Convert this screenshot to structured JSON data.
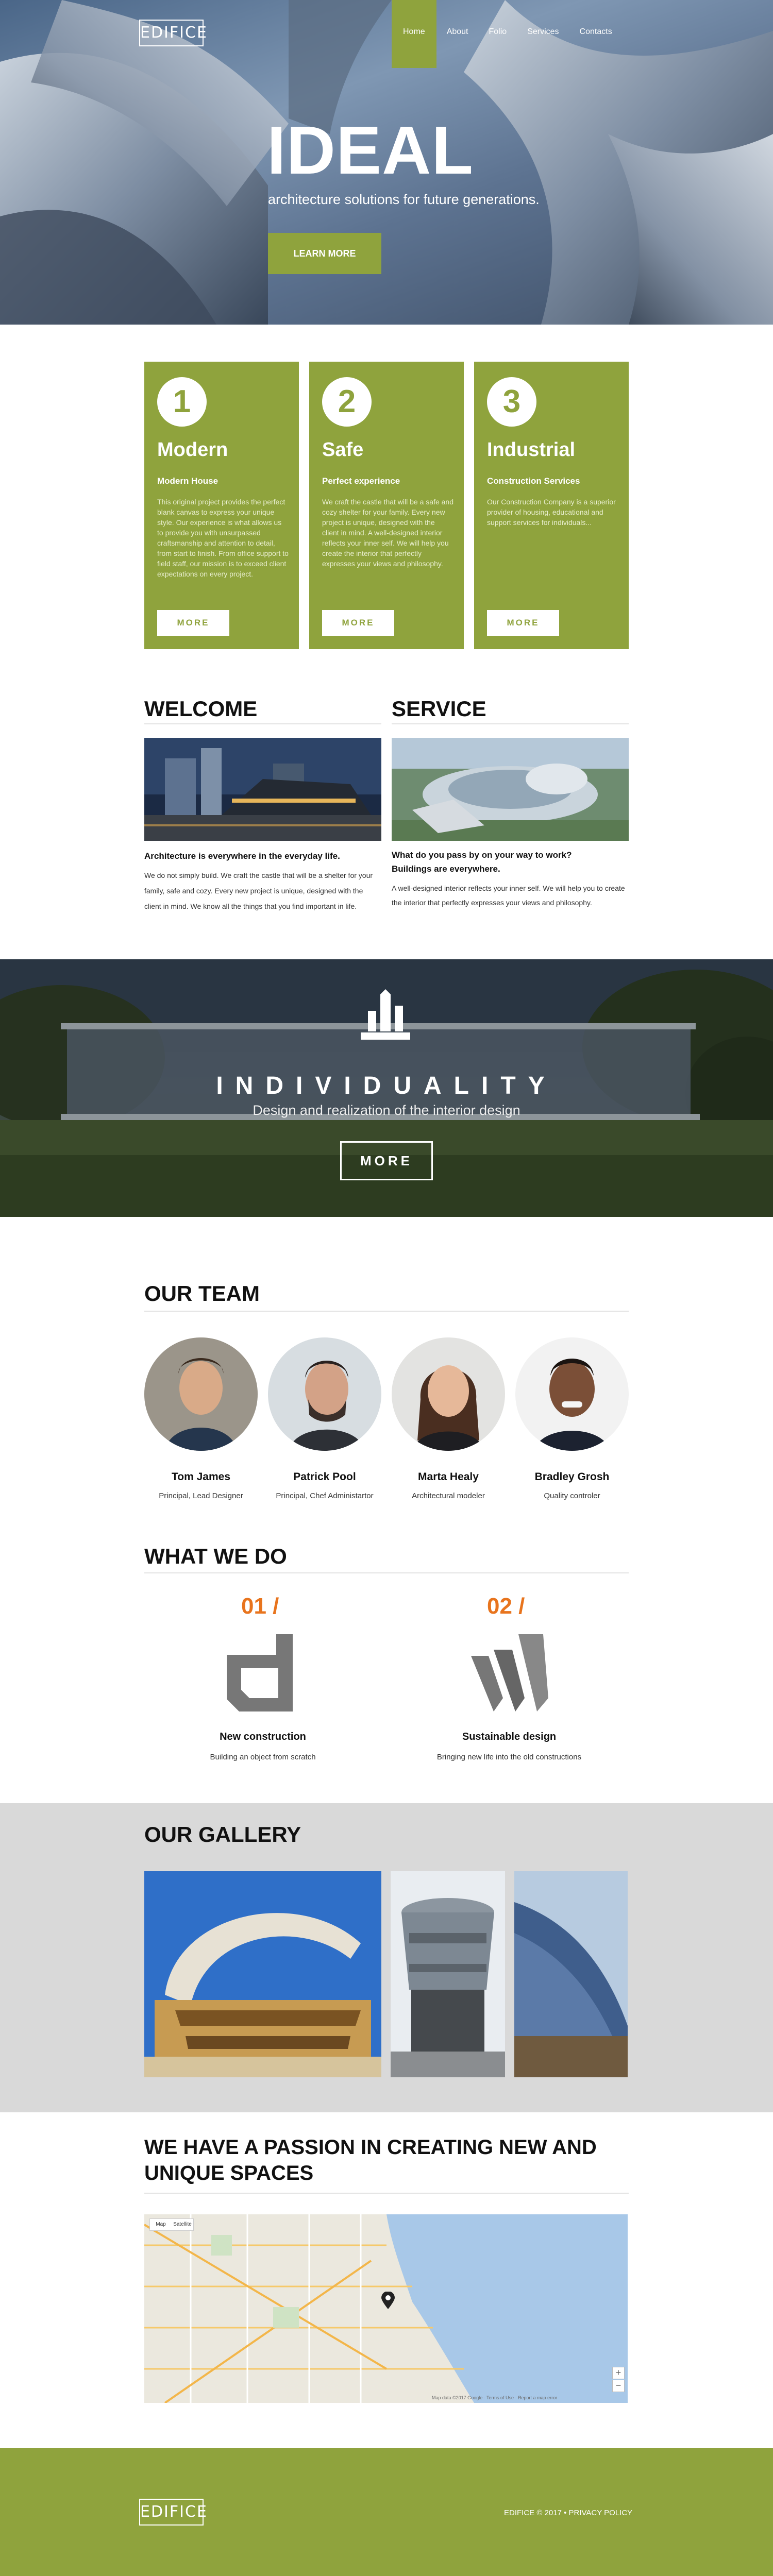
{
  "brand": {
    "logo_text": "EDIFICE",
    "accent_color": "#8fa33d",
    "orange": "#e8741d"
  },
  "nav": {
    "items": [
      "Home",
      "About",
      "Folio",
      "Services",
      "Contacts"
    ],
    "active": "Home"
  },
  "hero": {
    "title": "IDEAL",
    "subtitle": "architecture solutions for future generations.",
    "button": "LEARN MORE"
  },
  "features": [
    {
      "number": "1",
      "title": "Modern",
      "subtitle": "Modern House",
      "text": "This original project provides the perfect blank canvas to express your unique style. Our experience is what allows us to provide you with unsurpassed craftsmanship and attention to detail, from start to finish. From office support to field staff, our mission is to exceed client expectations on every project.",
      "button": "MORE"
    },
    {
      "number": "2",
      "title": "Safe",
      "subtitle": "Perfect experience",
      "text": "We craft the castle that will be a safe and cozy shelter for your family. Every new project is unique, designed with the client in mind. A well-designed interior reflects your inner self. We will help you create the interior that perfectly expresses your views and philosophy.",
      "button": "MORE"
    },
    {
      "number": "3",
      "title": "Industrial",
      "subtitle": "Construction Services",
      "text": "Our Construction Company is a superior provider of housing, educational and support services for individuals...",
      "button": "MORE"
    }
  ],
  "welcome": {
    "heading": "WELCOME",
    "bold": "Architecture is everywhere in the everyday life.",
    "text": "We do not simply build. We craft the castle that will be a shelter for your family, safe and cozy. Every new project is unique, designed with the client in mind. We know all the things that you find important in life."
  },
  "service": {
    "heading": "SERVICE",
    "bold_1": "What do you pass by on your way to work?",
    "bold_2": "Buildings are everywhere.",
    "text": "A well-designed interior reflects your inner self. We will help you to create the interior that perfectly expresses your views and philosophy."
  },
  "individuality": {
    "title": "INDIVIDUALITY",
    "subtitle": "Design and realization of the interior design",
    "button": "MORE"
  },
  "team": {
    "heading": "OUR TEAM",
    "members": [
      {
        "name": "Tom James",
        "role": "Principal, Lead Designer"
      },
      {
        "name": "Patrick Pool",
        "role": "Principal, Chef Administartor"
      },
      {
        "name": "Marta Healy",
        "role": "Architectural modeler"
      },
      {
        "name": "Bradley Grosh",
        "role": "Quality controler"
      }
    ]
  },
  "what_we_do": {
    "heading": "WHAT WE DO",
    "items": [
      {
        "number": "01 /",
        "title": "New construction",
        "desc": "Building an object from scratch",
        "icon": "construction-icon"
      },
      {
        "number": "02 /",
        "title": "Sustainable design",
        "desc": "Bringing new life into the old constructions",
        "icon": "sustainable-design-icon"
      }
    ]
  },
  "gallery": {
    "heading": "OUR GALLERY"
  },
  "passion": {
    "heading_line1": "WE HAVE A PASSION IN CREATING NEW AND",
    "heading_line2": "UNIQUE SPACES"
  },
  "map": {
    "type_map": "Map",
    "type_satellite": "Satellite",
    "zoom_in": "+",
    "zoom_out": "−",
    "attribution": "Map data ©2017 Google · Terms of Use · Report a map error"
  },
  "footer": {
    "logo_text": "EDIFICE",
    "copyright": "EDIFICE © 2017 • PRIVACY POLICY"
  }
}
